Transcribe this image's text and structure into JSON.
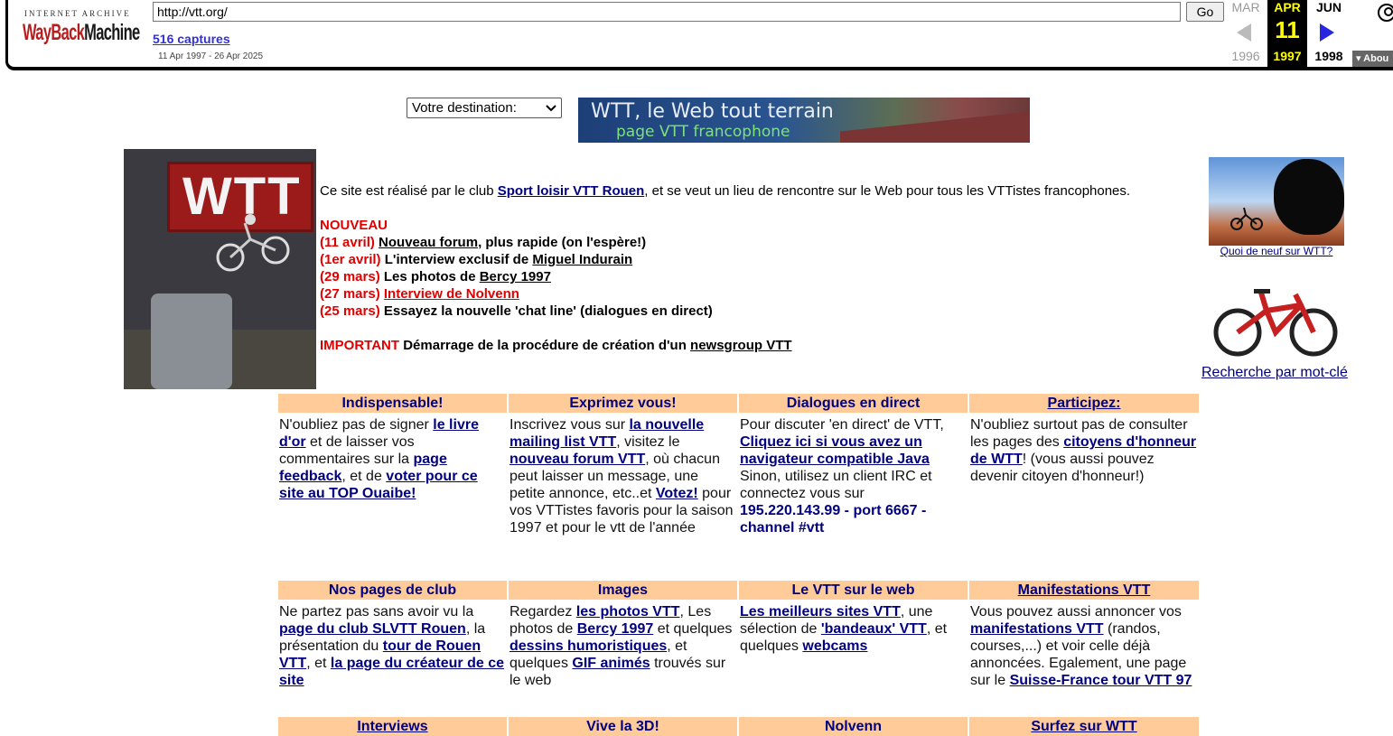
{
  "toolbar": {
    "logo_top": "INTERNET ARCHIVE",
    "logo_wayback": "WayBack",
    "logo_machine": "Machine",
    "url": "http://vtt.org/",
    "go_label": "Go",
    "captures": "516 captures",
    "range": "11 Apr 1997 - 26 Apr 2025",
    "prev_month": "MAR",
    "prev_year": "1996",
    "cur_month": "APR",
    "cur_day": "11",
    "cur_year": "1997",
    "next_month": "JUN",
    "next_year": "1998",
    "about": "Abou"
  },
  "header": {
    "destination_select": "Votre destination:",
    "banner_title": "WTT, le Web tout terrain",
    "banner_subtitle": "page VTT francophone",
    "main_photo_sign": "WTT"
  },
  "intro": {
    "before_link": "Ce site est réalisé par le club ",
    "club_link": "Sport loisir VTT Rouen",
    "after_link": ", et se veut un lieu de rencontre sur le Web pour tous les VTTistes francophones."
  },
  "news": {
    "heading": "NOUVEAU",
    "items": [
      {
        "date": "(11 avril) ",
        "link": "Nouveau forum",
        "rest": ", plus rapide (on l'espère!)"
      },
      {
        "date": "(1er avril) ",
        "pre": "L'interview exclusif de ",
        "link": "Miguel Indurain"
      },
      {
        "date": "(29 mars) ",
        "pre": "Les photos de ",
        "link": "Bercy 1997"
      },
      {
        "date": "(27 mars) ",
        "link": "Interview de Nolvenn"
      },
      {
        "date": "(25 mars) ",
        "rest": "Essayez la nouvelle 'chat line' (dialogues en direct)"
      }
    ],
    "important_label": "IMPORTANT",
    "important_text": " Démarrage de la procédure de création d'un ",
    "important_link": "newsgroup VTT"
  },
  "sidebar": {
    "rock_caption": "Quoi de neuf sur WTT?",
    "bike_caption": "Recherche par mot-clé"
  },
  "sections1": {
    "h1": "Indispensable!",
    "h2": "Exprimez vous!",
    "h3": "Dialogues en direct",
    "h4": "Participez:",
    "c1": {
      "t1": "N'oubliez pas de signer ",
      "l1": "le livre d'or",
      "t2": " et de laisser vos commentaires sur la ",
      "l2": "page feedback",
      "t3": ", et de ",
      "l3": "voter pour ce site au TOP Ouaibe!"
    },
    "c2": {
      "t1": "Inscrivez vous sur ",
      "l1": "la nouvelle mailing list VTT",
      "t2": ", visitez le ",
      "l2": "nouveau forum VTT",
      "t3": ", où chacun peut laisser un message, une petite annonce, etc..et ",
      "l3": "Votez!",
      "t4": " pour vos VTTistes favoris pour la saison 1997 et pour le vtt de l'année"
    },
    "c3": {
      "t1": "Pour discuter 'en direct' de VTT, ",
      "l1": "Cliquez ici si vous avez un navigateur compatible Java",
      "t2": " Sinon, utilisez un client IRC et connectez vous sur ",
      "b1": "195.220.143.99 - port 6667 - channel #vtt"
    },
    "c4": {
      "t1": "N'oubliez surtout pas de consulter les pages des ",
      "l1": "citoyens d'honneur de WTT",
      "t2": "! (vous aussi pouvez devenir citoyen d'honneur!)"
    }
  },
  "sections2": {
    "h1": "Nos pages de club",
    "h2": "Images",
    "h3": "Le VTT sur le web",
    "h4": "Manifestations VTT",
    "c1": {
      "t1": "Ne partez pas sans avoir vu la ",
      "l1": "page du club SLVTT Rouen",
      "t2": ", la présentation du ",
      "l2": "tour de Rouen VTT",
      "t3": ", et ",
      "l3": "la page du créateur de ce site"
    },
    "c2": {
      "t1": "Regardez ",
      "l1": "les photos VTT",
      "t2": ", Les photos de ",
      "l2": "Bercy 1997",
      "t3": " et quelques ",
      "l3": "dessins humoristiques",
      "t4": ", et quelques ",
      "l4": "GIF animés",
      "t5": " trouvés sur le web"
    },
    "c3": {
      "l1": "Les meilleurs sites VTT",
      "t1": ", une sélection de ",
      "l2": "'bandeaux' VTT",
      "t2": ", et quelques ",
      "l3": "webcams"
    },
    "c4": {
      "t1": "Vous pouvez aussi annoncer vos ",
      "l1": "manifestations VTT",
      "t2": " (randos, courses,...) et voir celle déjà annoncées. Egalement, une page sur le ",
      "l2": "Suisse-France tour VTT 97"
    }
  },
  "sections3": {
    "h1": "Interviews",
    "h2": "Vive la 3D!",
    "h3": "Nolvenn",
    "h4": "Surfez sur WTT"
  },
  "colors": {
    "header_bg": "#ffcc99",
    "link": "#000080",
    "news_red": "#e00000"
  }
}
